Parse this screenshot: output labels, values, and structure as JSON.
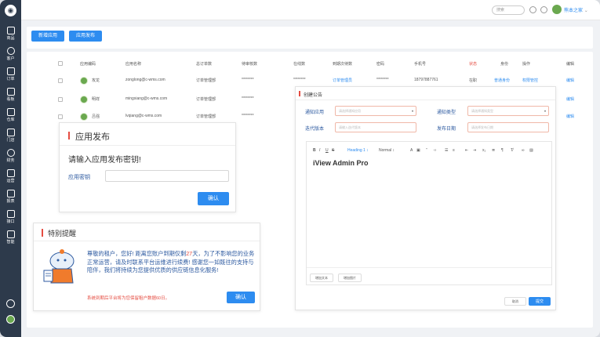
{
  "sidebar": {
    "items": [
      {
        "label": "商品",
        "icon": "box-icon"
      },
      {
        "label": "客户",
        "icon": "user-icon"
      },
      {
        "label": "订单",
        "icon": "clipboard-icon"
      },
      {
        "label": "看板",
        "icon": "board-icon"
      },
      {
        "label": "仓库",
        "icon": "warehouse-icon"
      },
      {
        "label": "门店",
        "icon": "store-icon"
      },
      {
        "label": "财务",
        "icon": "finance-icon"
      },
      {
        "label": "运营",
        "icon": "operations-icon"
      },
      {
        "label": "报表",
        "icon": "chart-icon"
      },
      {
        "label": "接口",
        "icon": "interface-icon"
      },
      {
        "label": "智能",
        "icon": "smart-icon"
      }
    ]
  },
  "header": {
    "search_placeholder": "搜索",
    "user_name": "熊本之家"
  },
  "toolbar": {
    "new_app_label": "新增应用",
    "publish_label": "应用发布"
  },
  "table": {
    "headers": [
      "应用编码",
      "应用名称",
      "总订单数",
      "待审核数",
      "在线数",
      "到期次待数",
      "密码",
      "手机号",
      "状态",
      "身份",
      "操作",
      "编辑"
    ],
    "rows": [
      {
        "code": "攻龙",
        "name": "zonglong@c-wms.com",
        "dept": "订单管理部",
        "pending": "********",
        "online": "********",
        "role": "订单管理员",
        "pwd": "********",
        "phone": "18797887761",
        "status": "在职",
        "identity": "普通身份",
        "op": "权限管控",
        "edit": "编辑"
      },
      {
        "code": "明祥",
        "name": "mingxiang@c-wms.com",
        "dept": "订单管理部",
        "pending": "********",
        "online": "",
        "role": "",
        "pwd": "",
        "phone": "",
        "status": "",
        "identity": "",
        "op": "",
        "edit": "编辑"
      },
      {
        "code": "吕强",
        "name": "lvqiang@c-wms.com",
        "dept": "订单管理部",
        "pending": "********",
        "online": "",
        "role": "",
        "pwd": "",
        "phone": "",
        "status": "",
        "identity": "",
        "op": "",
        "edit": "编辑"
      }
    ]
  },
  "publish_dialog": {
    "title": "应用发布",
    "prompt": "请输入应用发布密钥!",
    "key_label": "应用密钥",
    "confirm_label": "确认"
  },
  "notice_dialog": {
    "title": "特别提醒",
    "message_before": "尊敬的租户，您好! 距离您账户到期仅剩",
    "days": "27",
    "message_after": "天，为了不影响您的业务正常运营，请及时联系平台运维进行续费! 感谢您一如既往的支持与陪伴，我们将持续为您提供优质的供应链信息化服务!",
    "warning": "系统到期后平台将为您保留租户数据60日。",
    "confirm_label": "确认"
  },
  "announcement": {
    "title": "创建公告",
    "notify_app_label": "通知应用",
    "notify_app_placeholder": "请选择通知应用",
    "notify_type_label": "通知类型",
    "notify_type_placeholder": "请选择通知类型",
    "version_label": "迭代版本",
    "version_placeholder": "请输入迭代版本",
    "date_label": "发布日期",
    "date_placeholder": "请选择发布日期",
    "heading_select": "Heading 1",
    "size_select": "Normal",
    "editor_content": "iView Admin Pro",
    "add_text_label": "增加文本",
    "add_image_label": "增加图片",
    "cancel_label": "取消",
    "submit_label": "提交"
  }
}
